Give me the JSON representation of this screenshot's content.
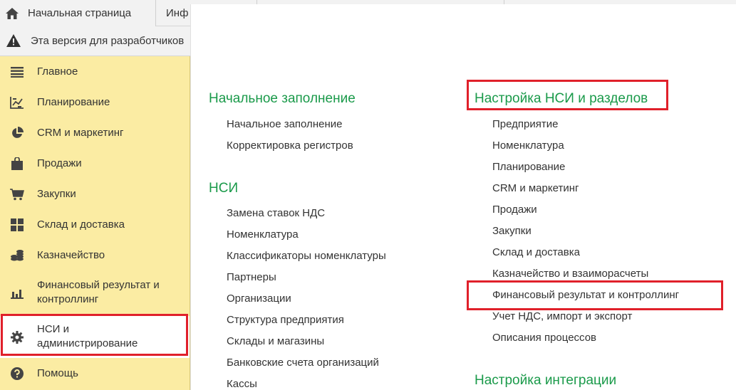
{
  "tabs": {
    "home_label": "Начальная страница",
    "info_label": "Инф"
  },
  "warning": {
    "text": "Эта версия для разработчиков"
  },
  "sidebar": {
    "items": [
      {
        "label": "Главное",
        "icon": "list-icon"
      },
      {
        "label": "Планирование",
        "icon": "chart-planning-icon"
      },
      {
        "label": "CRM и маркетинг",
        "icon": "pie-chart-icon"
      },
      {
        "label": "Продажи",
        "icon": "shopping-bag-icon"
      },
      {
        "label": "Закупки",
        "icon": "cart-icon"
      },
      {
        "label": "Склад и доставка",
        "icon": "warehouse-grid-icon"
      },
      {
        "label": "Казначейство",
        "icon": "coins-icon"
      },
      {
        "label": "Финансовый результат и контроллинг",
        "line1": "Финансовый результат и",
        "line2": "контроллинг",
        "icon": "bar-chart-icon"
      },
      {
        "label": "НСИ и администрирование",
        "line1": "НСИ и",
        "line2": "администрирование",
        "icon": "gear-icon",
        "active": true
      },
      {
        "label": "Помощь",
        "icon": "help-icon"
      }
    ]
  },
  "main": {
    "col1": {
      "sections": [
        {
          "title": "Начальное заполнение",
          "links": [
            "Начальное заполнение",
            "Корректировка регистров"
          ]
        },
        {
          "title": "НСИ",
          "links": [
            "Замена ставок НДС",
            "Номенклатура",
            "Классификаторы номенклатуры",
            "Партнеры",
            "Организации",
            "Структура предприятия",
            "Склады и магазины",
            "Банковские счета организаций",
            "Кассы"
          ]
        }
      ]
    },
    "col2": {
      "sections": [
        {
          "title": "Настройка НСИ и разделов",
          "links": [
            "Предприятие",
            "Номенклатура",
            "Планирование",
            "CRM и маркетинг",
            "Продажи",
            "Закупки",
            "Склад и доставка",
            "Казначейство и взаиморасчеты",
            "Финансовый результат и контроллинг",
            "Учет НДС, импорт и экспорт",
            "Описания процессов"
          ]
        },
        {
          "title": "Настройка интеграции",
          "links": []
        }
      ]
    }
  },
  "colors": {
    "sidebar_bg": "#fbeca3",
    "section_title": "#1a9a4a",
    "highlight": "#e0202a"
  }
}
